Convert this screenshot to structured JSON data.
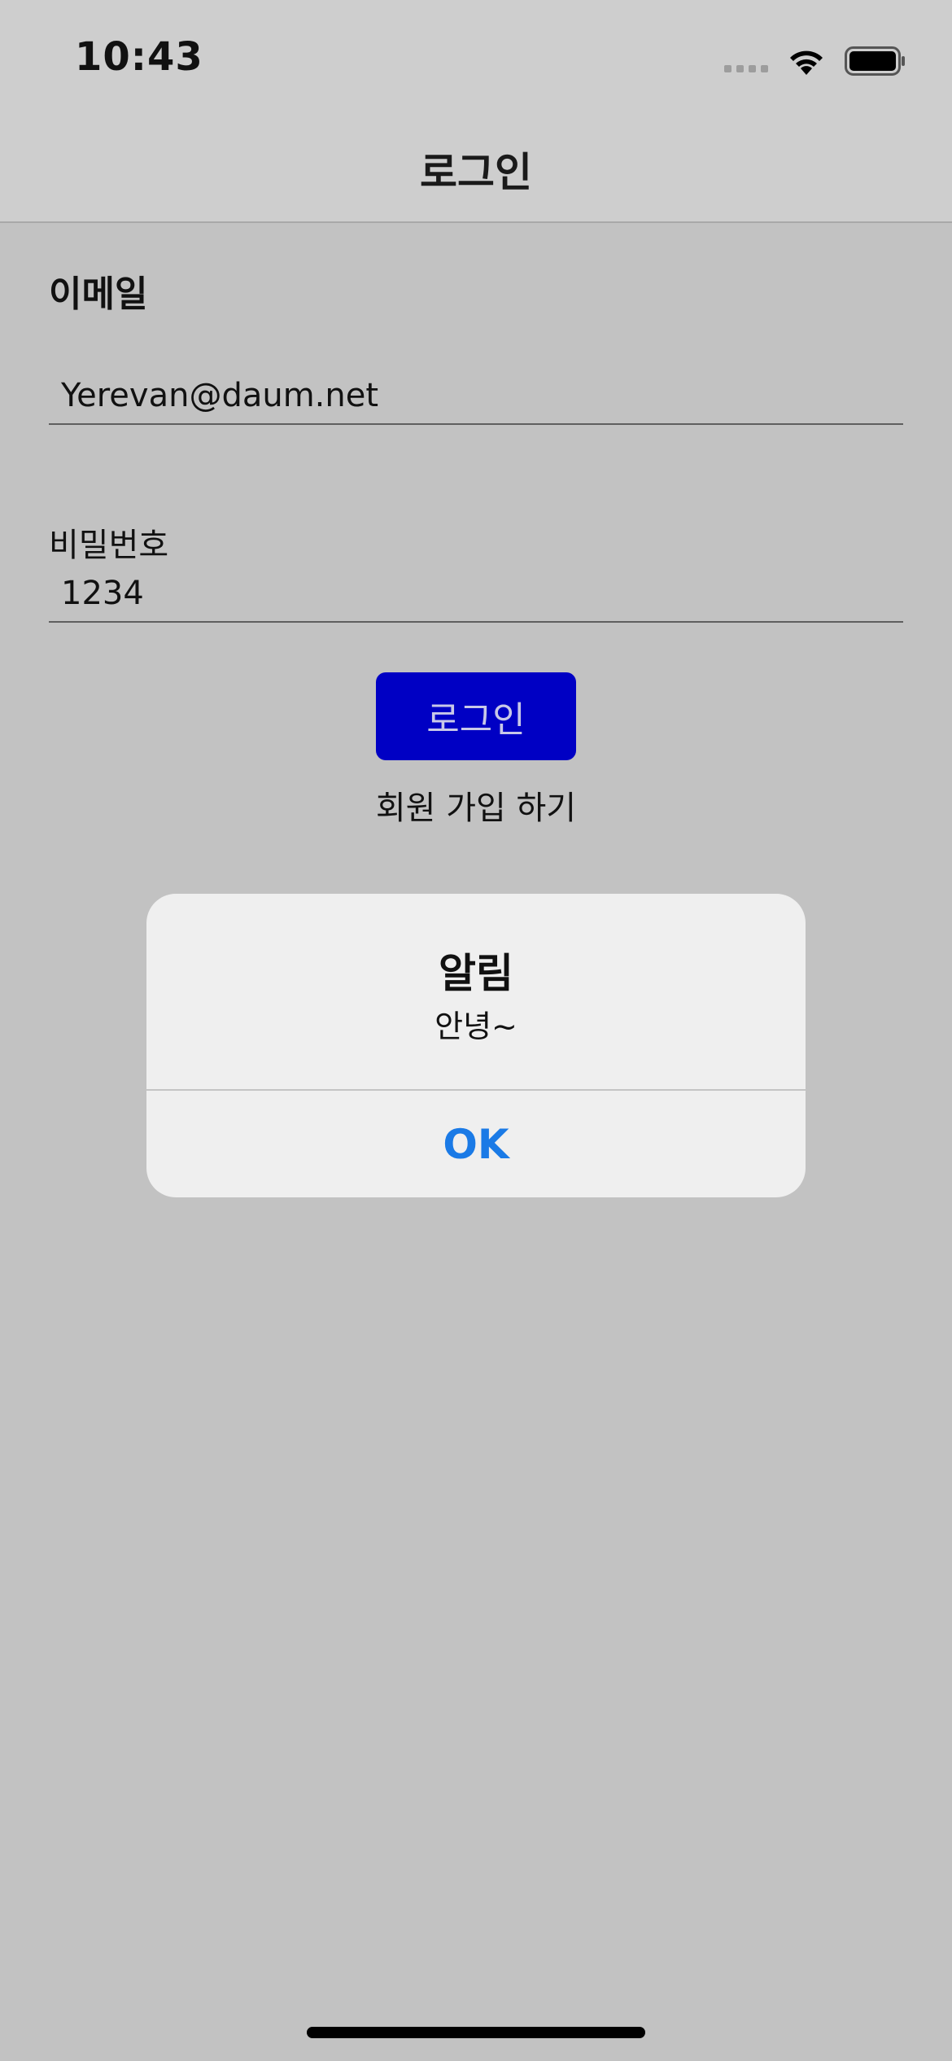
{
  "status_bar": {
    "time": "10:43",
    "icons": [
      "cellular-signal-icon",
      "wifi-icon",
      "battery-icon"
    ]
  },
  "nav": {
    "title": "로그인"
  },
  "form": {
    "email_label": "이메일",
    "email_value": "Yerevan@daum.net",
    "password_label": "비밀번호",
    "password_value": "1234",
    "login_button": "로그인",
    "signup_link": "회원 가입 하기"
  },
  "alert": {
    "title": "알림",
    "message": "안녕~",
    "ok_button": "OK"
  },
  "colors": {
    "background": "#c2c2c2",
    "login_button": "#0000c4",
    "alert_action": "#1a7ae6"
  }
}
